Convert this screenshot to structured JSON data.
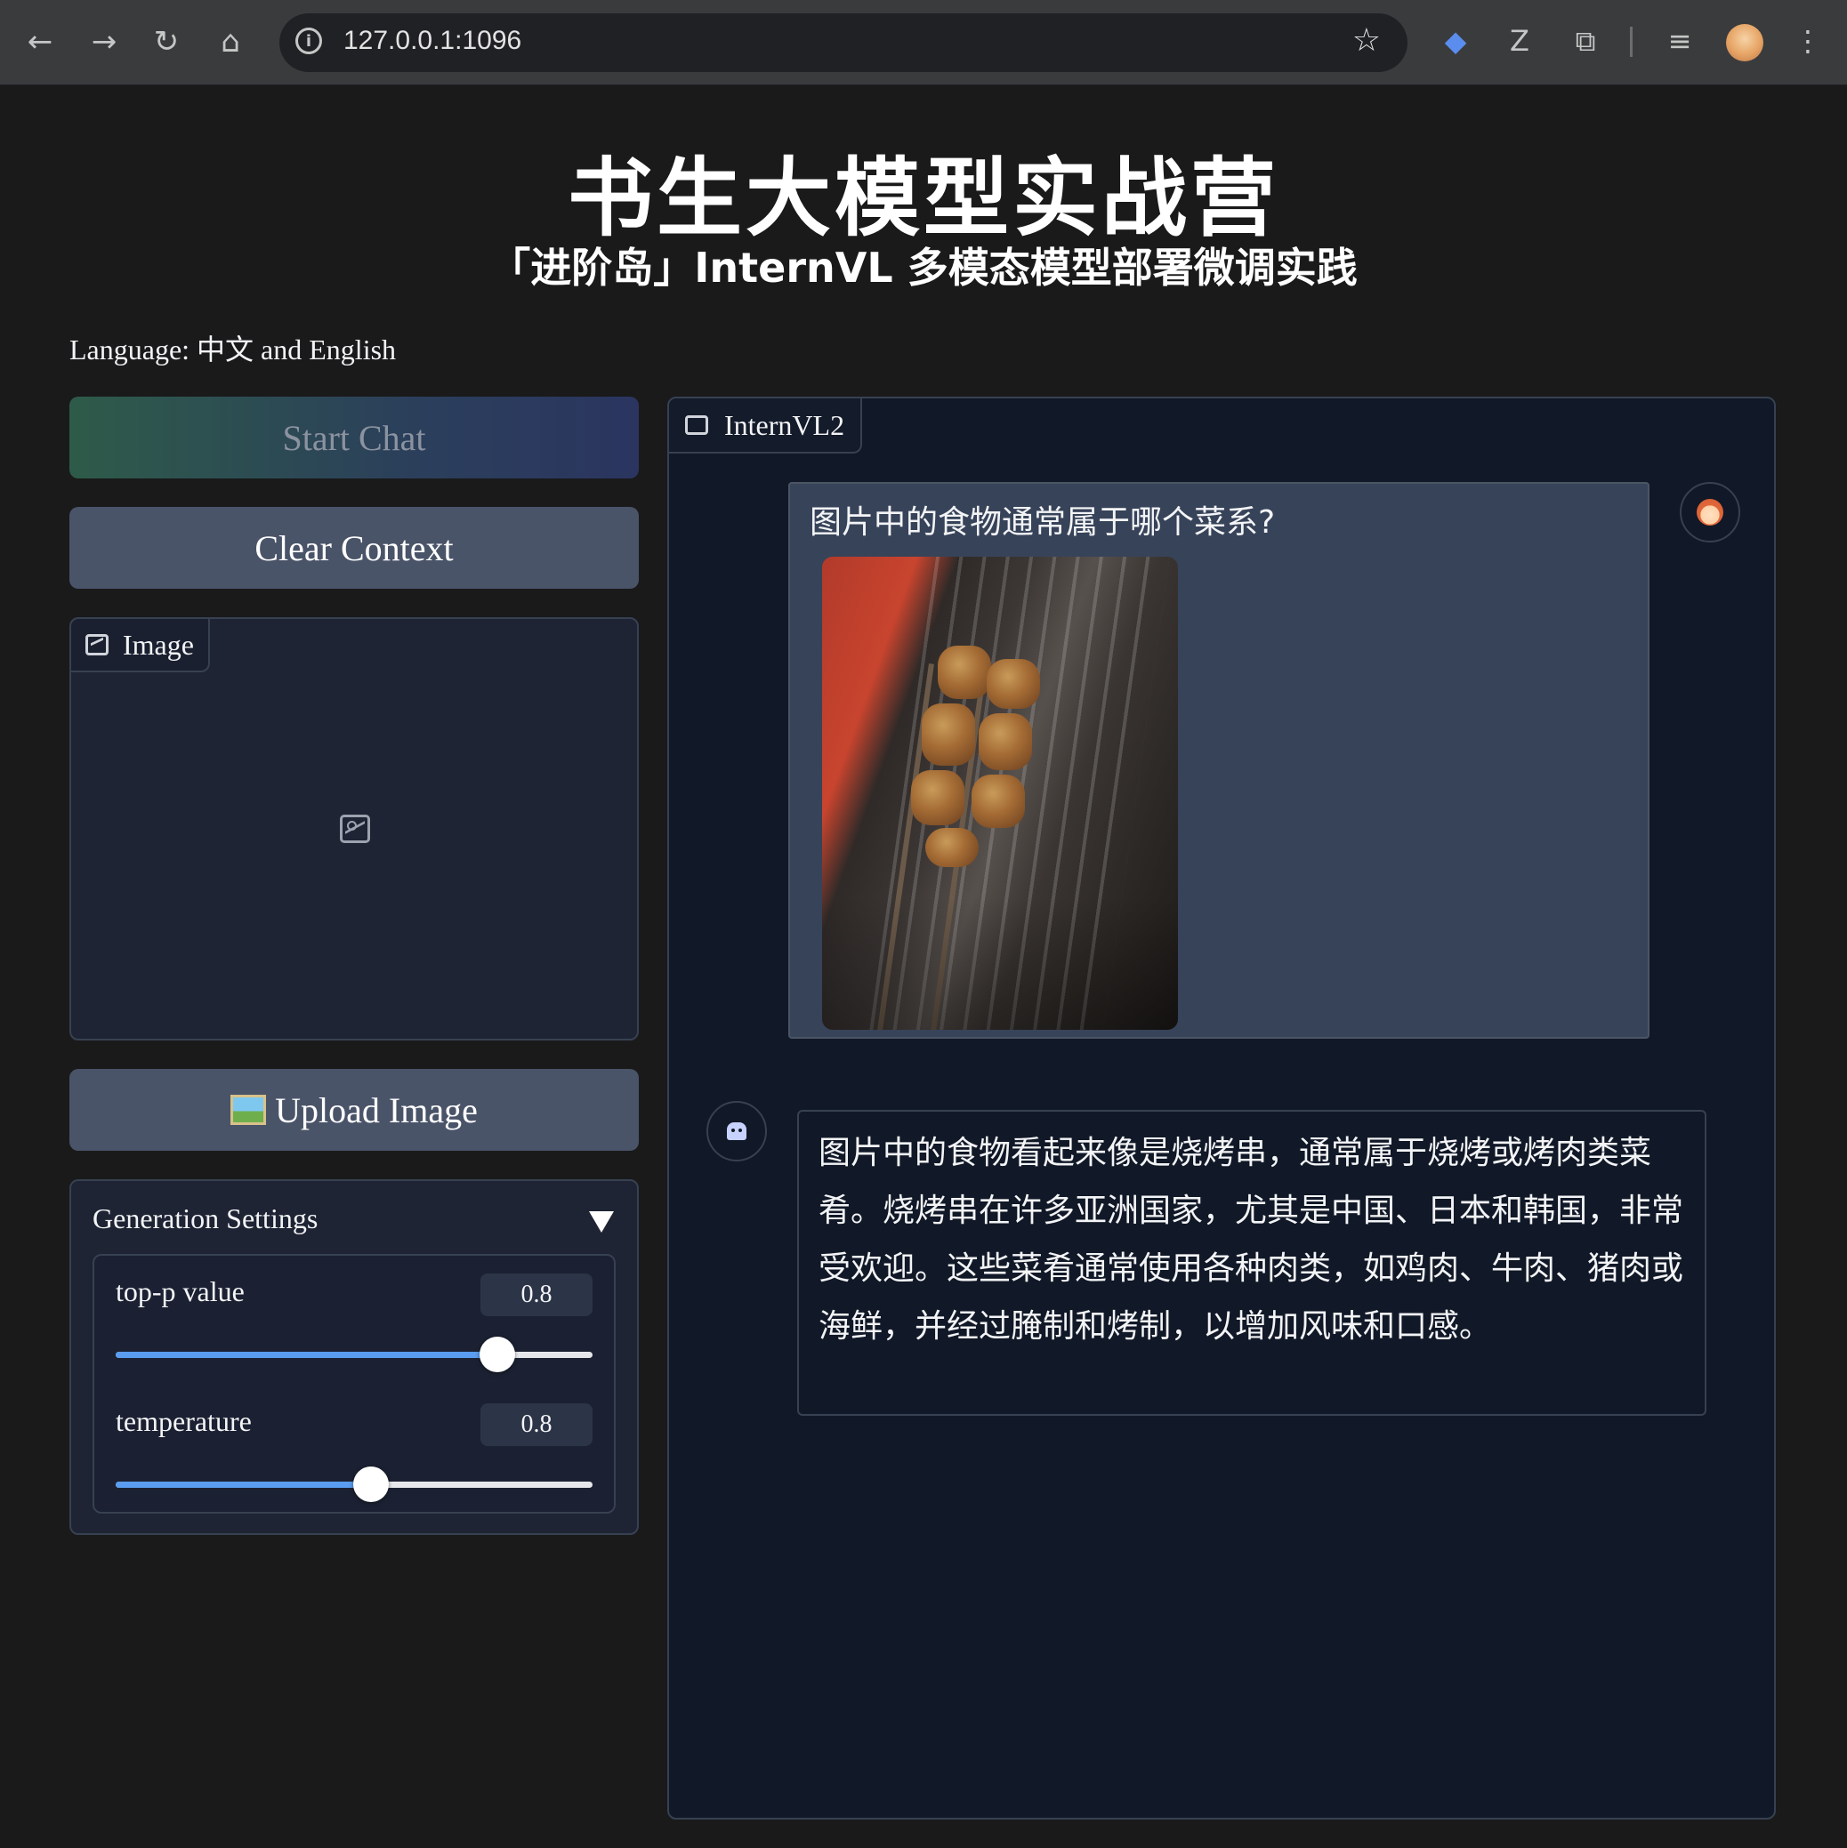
{
  "browser": {
    "url": "127.0.0.1:1096"
  },
  "page": {
    "title": "书生大模型实战营",
    "subtitle": "「进阶岛」InternVL 多模态模型部署微调实践",
    "language_note": "Language: 中文 and English"
  },
  "controls": {
    "start_chat_label": "Start Chat",
    "clear_context_label": "Clear Context",
    "image_panel_label": "Image",
    "upload_image_label": "Upload Image"
  },
  "settings": {
    "title": "Generation Settings",
    "sliders": [
      {
        "label": "top-p value",
        "value": "0.8",
        "fraction": 0.8
      },
      {
        "label": "temperature",
        "value": "0.8",
        "fraction": 0.535
      }
    ]
  },
  "chatbot": {
    "label": "InternVL2",
    "messages": [
      {
        "role": "user",
        "text": "图片中的食物通常属于哪个菜系?"
      },
      {
        "role": "assistant",
        "text": "图片中的食物看起来像是烧烤串，通常属于烧烤或烤肉类菜肴。烧烤串在许多亚洲国家，尤其是中国、日本和韩国，非常受欢迎。这些菜肴通常使用各种肉类，如鸡肉、牛肉、猪肉或海鲜，并经过腌制和烤制，以增加风味和口感。"
      }
    ]
  },
  "colors": {
    "background": "#1a1a1b",
    "panel": "#1e2434",
    "chat_background": "#111827",
    "button": "#4a5469",
    "slider_accent": "#5a9cf0"
  }
}
